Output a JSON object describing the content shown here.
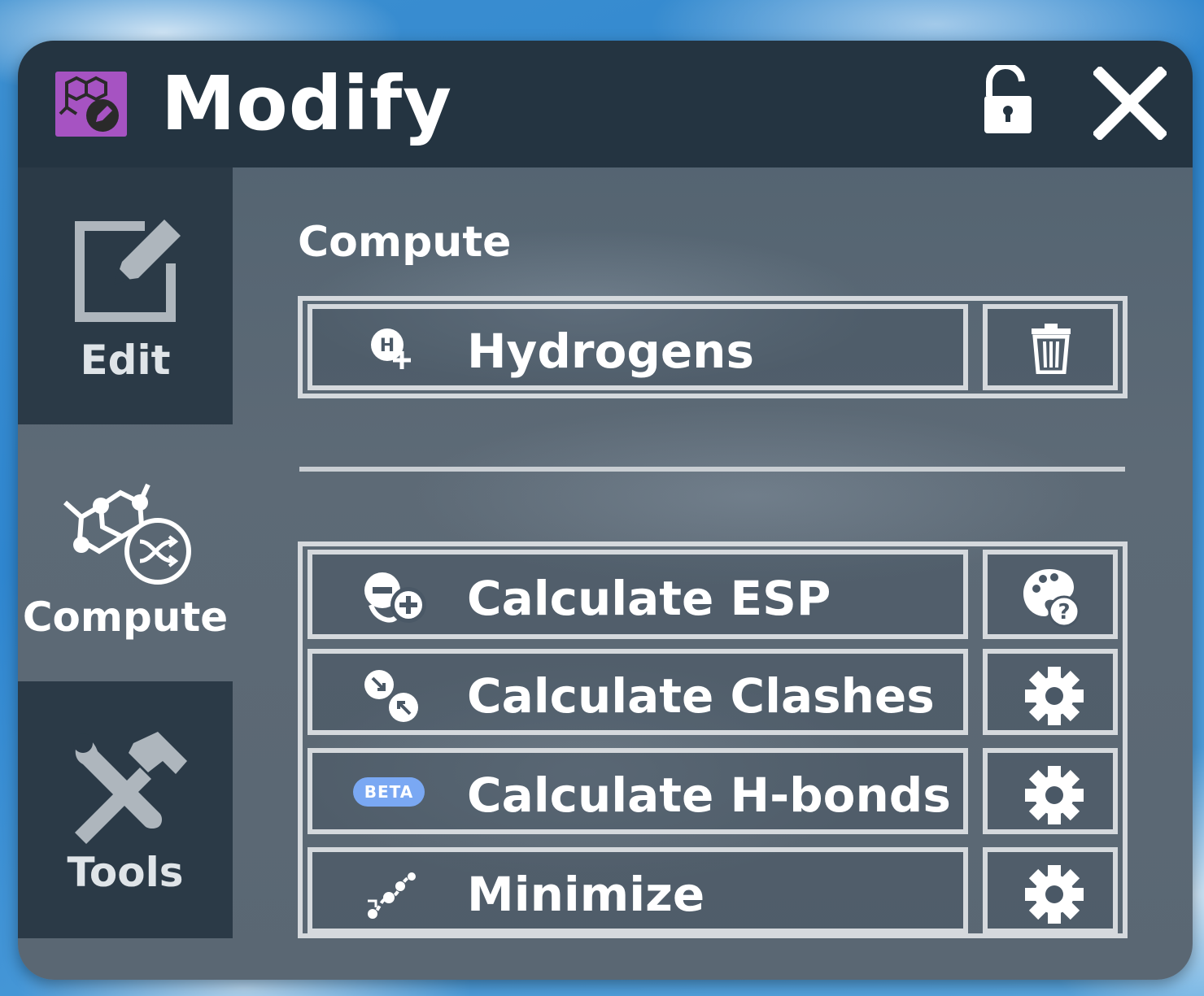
{
  "window": {
    "title": "Modify",
    "icon": "molecule-edit-icon",
    "accent_color": "#a653c2"
  },
  "sidebar": {
    "tabs": [
      {
        "label": "Edit",
        "icon": "edit-pencil-icon",
        "active": false
      },
      {
        "label": "Compute",
        "icon": "molecule-shuffle-icon",
        "active": true
      },
      {
        "label": "Tools",
        "icon": "wrench-hammer-icon",
        "active": false
      }
    ]
  },
  "main": {
    "section_title": "Compute",
    "hydrogens": {
      "label": "Hydrogens",
      "icon": "add-hydrogen-icon",
      "side_icon": "trash-icon"
    },
    "actions": [
      {
        "label": "Calculate ESP",
        "icon": "charge-plus-minus-icon",
        "side_icon": "palette-help-icon"
      },
      {
        "label": "Calculate Clashes",
        "icon": "clash-arrows-icon",
        "side_icon": "gear-icon"
      },
      {
        "label": "Calculate H-bonds",
        "icon": "beta-badge",
        "badge": "BETA",
        "side_icon": "gear-icon"
      },
      {
        "label": "Minimize",
        "icon": "minimize-path-icon",
        "side_icon": "gear-icon"
      }
    ]
  }
}
